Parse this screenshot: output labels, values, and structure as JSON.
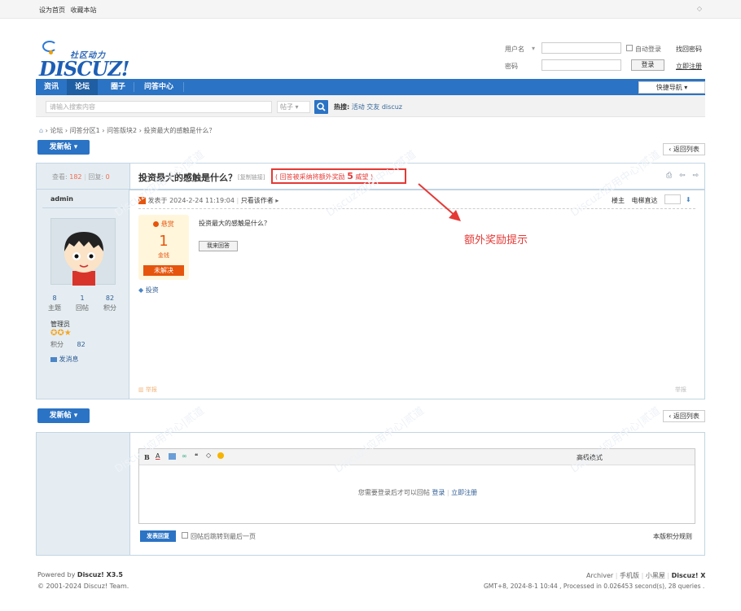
{
  "topbar": {
    "set_home": "设为首页",
    "bookmark": "收藏本站",
    "right_icon": "◇"
  },
  "logo": {
    "cn": "社区动力",
    "en": "DISCUZ!"
  },
  "login": {
    "username_label": "用户名",
    "password_label": "密码",
    "autologin": "自动登录",
    "login_btn": "登录",
    "forgot": "找回密码",
    "register": "立即注册"
  },
  "nav": {
    "items": [
      "资讯",
      "论坛",
      "圈子",
      "问答中心"
    ],
    "quick": "快捷导航"
  },
  "search": {
    "placeholder": "请输入搜索内容",
    "type": "帖子",
    "hot_label": "热搜:",
    "hot": [
      "活动",
      "交友",
      "discuz"
    ]
  },
  "breadcrumb": [
    "论坛",
    "问答分区1",
    "问答版块2",
    "投资最大的感触是什么？"
  ],
  "buttons": {
    "new_post": "发新帖",
    "back_list": "返回列表"
  },
  "thread": {
    "views_label": "查看:",
    "views": "182",
    "replies_label": "回复:",
    "replies": "0",
    "title": "投资最大的感触是什么？",
    "copy_link": "[复制链接]",
    "reward_pre": "( 回答被采纳将额外奖励",
    "reward_num": "5",
    "reward_post": "威望 )"
  },
  "post": {
    "author": "admin",
    "posted_at": "发表于 2024-2-24 11:19:04",
    "only_author": "只看该作者",
    "floor_label": "楼主",
    "jump": "电梯直达",
    "content": "投资最大的感触是什么？",
    "tag": "投资"
  },
  "user": {
    "threads": "8",
    "threads_label": "主题",
    "replies": "1",
    "replies_label": "回帖",
    "credits": "82",
    "credits_label": "积分",
    "group": "管理员",
    "credits_row_label": "积分",
    "credits_row": "82",
    "pm": "发消息"
  },
  "bounty": {
    "label": "悬赏",
    "amount": "1",
    "unit": "金钱",
    "status": "未解决",
    "answer_btn": "我来回答"
  },
  "annotation": "额外奖励提示",
  "reply": {
    "adv": "高级模式",
    "login_tip": "您需要登录后才可以回帖",
    "login": "登录",
    "register": "立即注册",
    "submit": "发表回复",
    "back_last": "回帖后跳转到最后一页",
    "rules": "本版积分规则"
  },
  "footer": {
    "powered_pre": "Powered by",
    "powered": "Discuz! X3.5",
    "copyright": "© 2001-2024 Discuz! Team.",
    "links": [
      "Archiver",
      "手机版",
      "小黑屋"
    ],
    "brand": "Discuz! X",
    "gmt": "GMT+8, 2024-8-1 10:44 , Processed in 0.026453 second(s), 28 queries ."
  },
  "watermark": "Discuz!应用中心|贰道",
  "colors": {
    "brand_blue": "#2b73c4",
    "reward_red": "#e53935",
    "orange": "#e6550d"
  }
}
